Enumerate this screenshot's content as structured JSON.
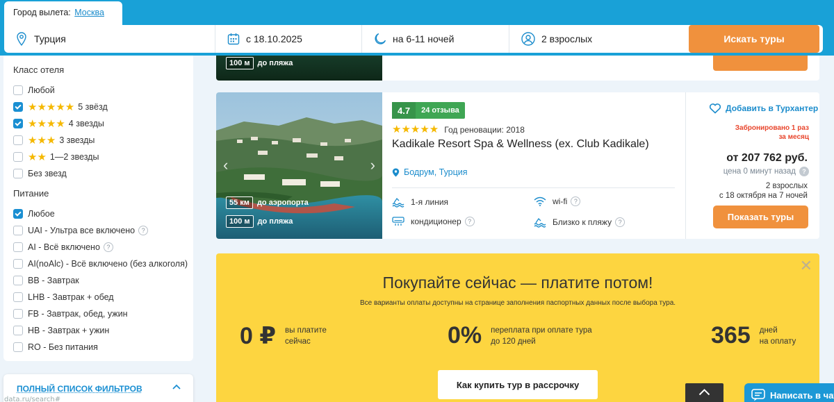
{
  "search": {
    "departure_label": "Город вылета:",
    "departure_city": "Москва",
    "destination": "Турция",
    "date": "с 18.10.2025",
    "nights": "на 6-11 ночей",
    "tourists": "2 взрослых",
    "search_button": "Искать туры"
  },
  "filters": {
    "hotel_class_title": "Класс отеля",
    "hotel_class": [
      {
        "label": "Любой",
        "stars": 0,
        "checked": false
      },
      {
        "label": "5 звёзд",
        "stars": 5,
        "checked": true
      },
      {
        "label": "4 звезды",
        "stars": 4,
        "checked": true
      },
      {
        "label": "3 звезды",
        "stars": 3,
        "checked": false
      },
      {
        "label": "1—2 звезды",
        "stars": 2,
        "checked": false
      },
      {
        "label": "Без звезд",
        "stars": 0,
        "checked": false
      }
    ],
    "meals_title": "Питание",
    "meals": [
      {
        "label": "Любое",
        "checked": true,
        "help": false
      },
      {
        "label": "UAI - Ультра все включено",
        "checked": false,
        "help": true
      },
      {
        "label": "AI - Всё включено",
        "checked": false,
        "help": true
      },
      {
        "label": "AI(noAlc) - Всё включено (без алкоголя)",
        "checked": false,
        "help": false
      },
      {
        "label": "BB - Завтрак",
        "checked": false,
        "help": false
      },
      {
        "label": "LHB - Завтрак + обед",
        "checked": false,
        "help": false
      },
      {
        "label": "FB - Завтрак, обед, ужин",
        "checked": false,
        "help": false
      },
      {
        "label": "HB - Завтрак + ужин",
        "checked": false,
        "help": false
      },
      {
        "label": "RO - Без питания",
        "checked": false,
        "help": false
      }
    ],
    "full_list_label": "ПОЛНЫЙ СПИСОК ФИЛЬТРОВ"
  },
  "url_hint": "data.ru/search#",
  "prev_card": {
    "beach_distance": "100 м",
    "beach_label": "до пляжа"
  },
  "hotel": {
    "score": "4.7",
    "reviews": "24 отзыва",
    "stars": 5,
    "renovation": "Год реновации: 2018",
    "name": "Kadikale Resort Spa & Wellness (ex. Club Kadikale)",
    "location": "Бодрум, Турция",
    "airport_distance": "55 км",
    "airport_label": "до аэропорта",
    "beach_distance": "100 м",
    "beach_label": "до пляжа",
    "amenities": {
      "line": "1-я линия",
      "wifi": "wi-fi",
      "ac": "кондиционер",
      "near_beach": "Близко к пляжу"
    },
    "favorite": "Добавить в Турхантер",
    "booked_note": "Забронировано 1 раз за месяц",
    "price": "от 207 762 руб.",
    "price_age": "цена 0 минут назад",
    "guests": "2 взрослых",
    "dates": "с 18 октября на 7 ночей",
    "show_button": "Показать туры"
  },
  "promo": {
    "title": "Покупайте сейчас — платите потом!",
    "subtitle": "Все варианты оплаты доступны на странице заполнения паспортных данных после выбора тура.",
    "stat1_big": "0 ₽",
    "stat1_line1": "вы платите",
    "stat1_line2": "сейчас",
    "stat2_big": "0%",
    "stat2_line1": "переплата при оплате тура",
    "stat2_line2": "до 120 дней",
    "stat3_big": "365",
    "stat3_line1": "дней",
    "stat3_line2": "на оплату",
    "button": "Как купить тур в рассрочку"
  },
  "chat": {
    "label": "Написать в чат"
  },
  "colors": {
    "brand_blue": "#19a1d7",
    "accent_orange": "#f0913d",
    "rating_green": "#3fa654",
    "promo_yellow": "#fdd540",
    "star_yellow": "#f5b800",
    "alert_red": "#e8452c"
  }
}
